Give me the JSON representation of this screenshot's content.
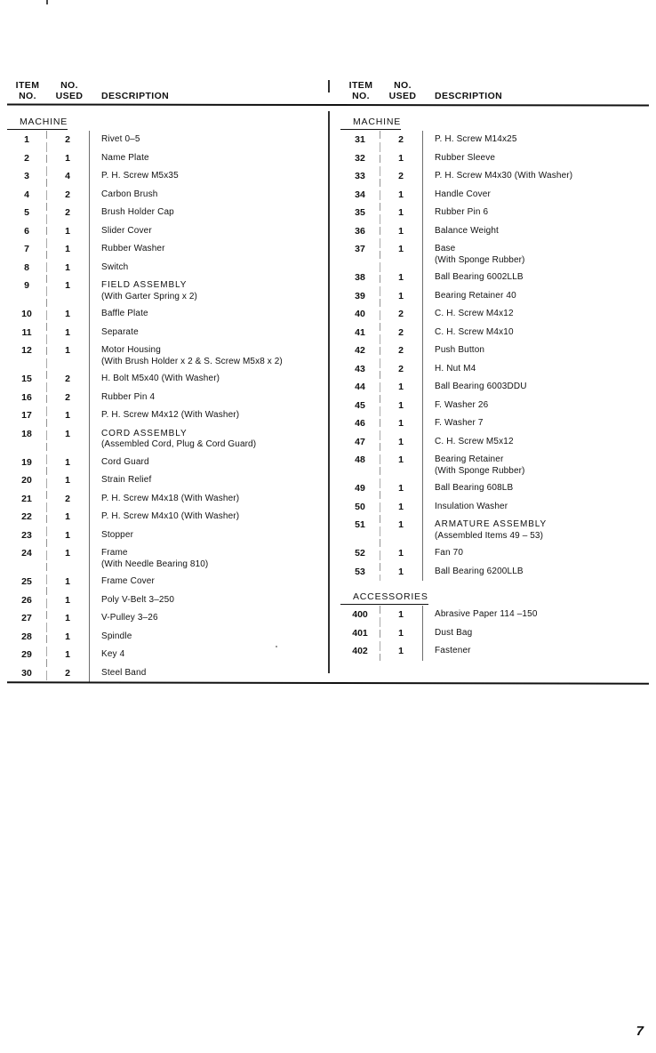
{
  "page_number": "7",
  "headers": {
    "item_no_line1": "ITEM",
    "item_no_line2": "NO.",
    "no_used_line1": "NO.",
    "no_used_line2": "USED",
    "description": "DESCRIPTION"
  },
  "left_column": {
    "section": "MACHINE",
    "rows": [
      {
        "item": "1",
        "used": "2",
        "desc": "Rivet  0–5"
      },
      {
        "item": "2",
        "used": "1",
        "desc": "Name Plate"
      },
      {
        "item": "3",
        "used": "4",
        "desc": "P. H. Screw  M5x35"
      },
      {
        "item": "4",
        "used": "2",
        "desc": "Carbon Brush"
      },
      {
        "item": "5",
        "used": "2",
        "desc": "Brush Holder Cap"
      },
      {
        "item": "6",
        "used": "1",
        "desc": "Slider Cover"
      },
      {
        "item": "7",
        "used": "1",
        "desc": "Rubber Washer"
      },
      {
        "item": "8",
        "used": "1",
        "desc": "Switch"
      },
      {
        "item": "9",
        "used": "1",
        "desc": "FIELD ASSEMBLY",
        "sub": "(With Garter Spring x 2)",
        "assembly": true
      },
      {
        "item": "10",
        "used": "1",
        "desc": "Baffle Plate"
      },
      {
        "item": "11",
        "used": "1",
        "desc": "Separate"
      },
      {
        "item": "12",
        "used": "1",
        "desc": "Motor Housing",
        "sub": "(With Brush Holder x 2 & S. Screw M5x8 x 2)"
      },
      {
        "item": "15",
        "used": "2",
        "desc": "H. Bolt  M5x40  (With Washer)"
      },
      {
        "item": "16",
        "used": "2",
        "desc": "Rubber Pin  4"
      },
      {
        "item": "17",
        "used": "1",
        "desc": "P. H. Screw  M4x12  (With Washer)"
      },
      {
        "item": "18",
        "used": "1",
        "desc": "CORD ASSEMBLY",
        "sub": "(Assembled Cord, Plug & Cord Guard)",
        "assembly": true
      },
      {
        "item": "19",
        "used": "1",
        "desc": "Cord Guard"
      },
      {
        "item": "20",
        "used": "1",
        "desc": "Strain Relief"
      },
      {
        "item": "21",
        "used": "2",
        "desc": "P. H. Screw  M4x18  (With Washer)"
      },
      {
        "item": "22",
        "used": "1",
        "desc": "P. H. Screw  M4x10  (With Washer)"
      },
      {
        "item": "23",
        "used": "1",
        "desc": "Stopper"
      },
      {
        "item": "24",
        "used": "1",
        "desc": "Frame",
        "sub": "(With Needle Bearing  810)"
      },
      {
        "item": "25",
        "used": "1",
        "desc": "Frame Cover"
      },
      {
        "item": "26",
        "used": "1",
        "desc": "Poly V-Belt  3–250"
      },
      {
        "item": "27",
        "used": "1",
        "desc": "V-Pulley  3–26"
      },
      {
        "item": "28",
        "used": "1",
        "desc": "Spindle"
      },
      {
        "item": "29",
        "used": "1",
        "desc": "Key  4"
      },
      {
        "item": "30",
        "used": "2",
        "desc": "Steel Band"
      }
    ]
  },
  "right_column": {
    "section": "MACHINE",
    "rows": [
      {
        "item": "31",
        "used": "2",
        "desc": "P. H. Screw  M14x25"
      },
      {
        "item": "32",
        "used": "1",
        "desc": "Rubber Sleeve"
      },
      {
        "item": "33",
        "used": "2",
        "desc": "P. H. Screw  M4x30  (With Washer)"
      },
      {
        "item": "34",
        "used": "1",
        "desc": "Handle Cover"
      },
      {
        "item": "35",
        "used": "1",
        "desc": "Rubber Pin  6"
      },
      {
        "item": "36",
        "used": "1",
        "desc": "Balance Weight"
      },
      {
        "item": "37",
        "used": "1",
        "desc": "Base",
        "sub": "(With Sponge Rubber)"
      },
      {
        "item": "38",
        "used": "1",
        "desc": "Ball Bearing  6002LLB"
      },
      {
        "item": "39",
        "used": "1",
        "desc": "Bearing Retainer  40"
      },
      {
        "item": "40",
        "used": "2",
        "desc": "C. H. Screw  M4x12"
      },
      {
        "item": "41",
        "used": "2",
        "desc": "C. H. Screw  M4x10"
      },
      {
        "item": "42",
        "used": "2",
        "desc": "Push Button"
      },
      {
        "item": "43",
        "used": "2",
        "desc": "H. Nut  M4"
      },
      {
        "item": "44",
        "used": "1",
        "desc": "Ball Bearing  6003DDU"
      },
      {
        "item": "45",
        "used": "1",
        "desc": "F. Washer  26"
      },
      {
        "item": "46",
        "used": "1",
        "desc": "F. Washer  7"
      },
      {
        "item": "47",
        "used": "1",
        "desc": "C. H. Screw  M5x12"
      },
      {
        "item": "48",
        "used": "1",
        "desc": "Bearing Retainer",
        "sub": "(With Sponge Rubber)"
      },
      {
        "item": "49",
        "used": "1",
        "desc": "Ball Bearing  608LB"
      },
      {
        "item": "50",
        "used": "1",
        "desc": "Insulation Washer"
      },
      {
        "item": "51",
        "used": "1",
        "desc": "ARMATURE ASSEMBLY",
        "sub": "(Assembled Items 49 – 53)",
        "assembly": true
      },
      {
        "item": "52",
        "used": "1",
        "desc": "Fan  70"
      },
      {
        "item": "53",
        "used": "1",
        "desc": "Ball Bearing  6200LLB"
      }
    ],
    "section2": "ACCESSORIES",
    "rows2": [
      {
        "item": "400",
        "used": "1",
        "desc": "Abrasive Paper  114 –150"
      },
      {
        "item": "401",
        "used": "1",
        "desc": "Dust Bag"
      },
      {
        "item": "402",
        "used": "1",
        "desc": "Fastener"
      }
    ]
  }
}
